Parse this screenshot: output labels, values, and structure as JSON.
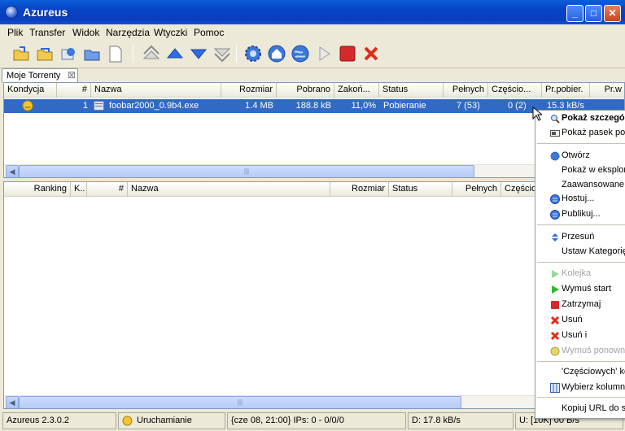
{
  "window": {
    "title": "Azureus",
    "minimize": "_",
    "maximize": "□",
    "close": "✕"
  },
  "menu": [
    "Plik",
    "Transfer",
    "Widok",
    "Narzędzia",
    "Wtyczki",
    "Pomoc"
  ],
  "tab": {
    "label": "Moje Torrenty",
    "close": "⊠"
  },
  "downloads": {
    "columns": [
      "Kondycja",
      "#",
      "Nazwa",
      "Rozmiar",
      "Pobrano",
      "Zakoń...",
      "Status",
      "Pełnych",
      "Częścio...",
      "Pr.pobier.",
      "Pr.w"
    ],
    "rows": [
      {
        "num": "1",
        "name": "foobar2000_0.9b4.exe",
        "size": "1.4 MB",
        "downloaded": "188.8 kB",
        "done": "11,0%",
        "status": "Pobieranie",
        "seeds": "7 (53)",
        "peers": "0 (2)",
        "down": "15.3 kB/s"
      }
    ]
  },
  "seeding": {
    "columns": [
      "Ranking",
      "K..",
      "#",
      "Nazwa",
      "Rozmiar",
      "Status",
      "Pełnych",
      "Częścio"
    ]
  },
  "status": {
    "version": "Azureus 2.3.0.2",
    "state": "Uruchamianie",
    "ips": "{cze 08, 21:00} IPs: 0 - 0/0/0",
    "download": "D: 17.8 kB/s",
    "upload": "U: [10K] 00 B/s"
  },
  "context_menu": {
    "items": [
      {
        "label": "Pokaż szczegó",
        "icon": "magnifier-icon",
        "bold": true
      },
      {
        "label": "Pokaż pasek pob",
        "icon": "bar-icon"
      },
      {
        "label": "Otwórz",
        "icon": "gear-icon"
      },
      {
        "label": "Pokaż w eksplora"
      },
      {
        "label": "Zaawansowane"
      },
      {
        "label": "Hostuj...",
        "icon": "globe-icon"
      },
      {
        "label": "Publikuj...",
        "icon": "globe-icon"
      },
      {
        "label": "Przesuń",
        "icon": "updown-icon"
      },
      {
        "label": "Ustaw Kategorię"
      },
      {
        "label": "Kolejka",
        "icon": "play-icon",
        "disabled": true
      },
      {
        "label": "Wymuś start",
        "icon": "play-icon"
      },
      {
        "label": "Zatrzymaj",
        "icon": "stop-icon"
      },
      {
        "label": "Usuń",
        "icon": "x-icon"
      },
      {
        "label": "Usuń i",
        "icon": "x-icon"
      },
      {
        "label": "Wymuś ponowne",
        "icon": "recheck-icon",
        "disabled": true
      },
      {
        "label": "'Częściowych' ko"
      },
      {
        "label": "Wybierz kolumny",
        "icon": "columns-icon"
      },
      {
        "label": "Kopiuj URL do sc"
      }
    ]
  },
  "colors": {
    "selection": "#316ac5",
    "titlebar": "#0843c5",
    "stop": "#d42a2a",
    "remove": "#e02a1a"
  }
}
